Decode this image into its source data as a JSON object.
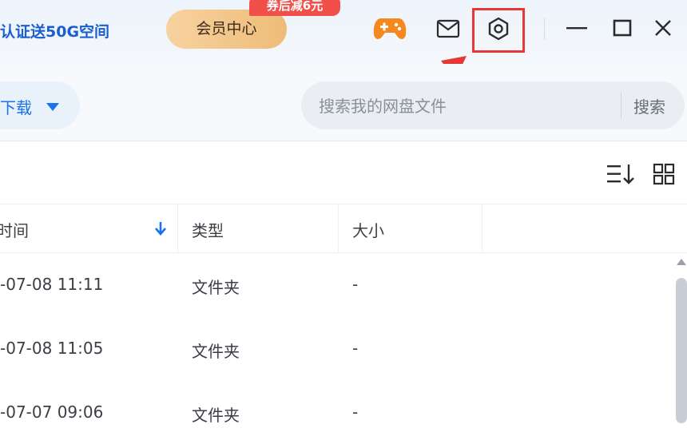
{
  "header": {
    "promo_text": "认证送50G空间",
    "vip_label": "会员中心",
    "vip_badge": "券后减6元",
    "icons": [
      "game-icon",
      "mail-icon",
      "settings-icon",
      "minimize-icon",
      "maximize-icon",
      "close-icon"
    ]
  },
  "toolbar": {
    "download_label": "下载",
    "search_placeholder": "搜索我的网盘文件",
    "search_button": "搜索"
  },
  "table": {
    "columns": [
      "时间",
      "类型",
      "大小"
    ],
    "rows": [
      {
        "time": "-07-08 11:11",
        "type": "文件夹",
        "size": "-"
      },
      {
        "time": "-07-08 11:05",
        "type": "文件夹",
        "size": "-"
      },
      {
        "time": "-07-07 09:06",
        "type": "文件夹",
        "size": "-"
      }
    ]
  },
  "colors": {
    "accent": "#1a73e8",
    "highlight": "#e53935",
    "vip_gold": "#eebc78",
    "badge_red": "#f1504a"
  }
}
